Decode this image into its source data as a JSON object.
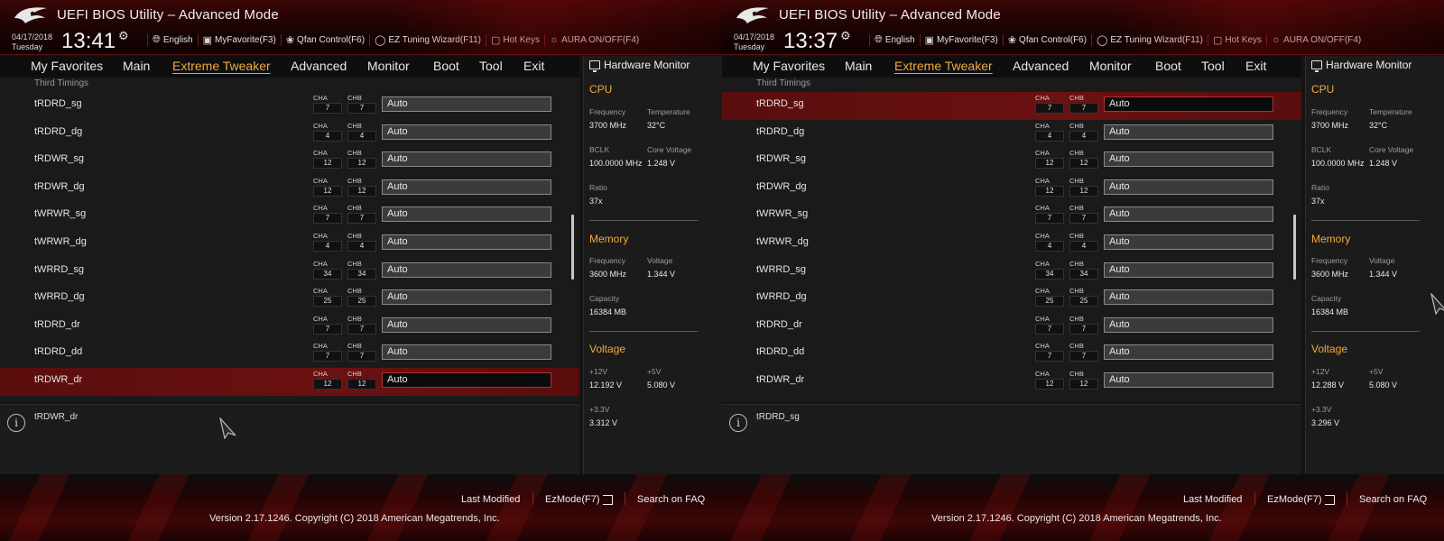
{
  "screens": [
    {
      "title": "UEFI BIOS Utility – Advanced Mode",
      "date": "04/17/2018",
      "weekday": "Tuesday",
      "time": "13:41",
      "header_menu": {
        "language": "English",
        "my_favorite": "MyFavorite(F3)",
        "qfan": "Qfan Control(F6)",
        "ez_tuning": "EZ Tuning Wizard(F11)",
        "hot_keys": "Hot Keys",
        "aura": "AURA ON/OFF(F4)"
      },
      "tabs": [
        "My Favorites",
        "Main",
        "Extreme Tweaker",
        "Advanced",
        "Monitor",
        "Boot",
        "Tool",
        "Exit"
      ],
      "active_tab": "Extreme Tweaker",
      "section": "Third Timings",
      "channel_labels": {
        "a": "CHA",
        "b": "CHB"
      },
      "rows": [
        {
          "label": "tRDRD_sg",
          "cha": "7",
          "chb": "7",
          "value": "Auto"
        },
        {
          "label": "tRDRD_dg",
          "cha": "4",
          "chb": "4",
          "value": "Auto"
        },
        {
          "label": "tRDWR_sg",
          "cha": "12",
          "chb": "12",
          "value": "Auto"
        },
        {
          "label": "tRDWR_dg",
          "cha": "12",
          "chb": "12",
          "value": "Auto"
        },
        {
          "label": "tWRWR_sg",
          "cha": "7",
          "chb": "7",
          "value": "Auto"
        },
        {
          "label": "tWRWR_dg",
          "cha": "4",
          "chb": "4",
          "value": "Auto"
        },
        {
          "label": "tWRRD_sg",
          "cha": "34",
          "chb": "34",
          "value": "Auto"
        },
        {
          "label": "tWRRD_dg",
          "cha": "25",
          "chb": "25",
          "value": "Auto"
        },
        {
          "label": "tRDRD_dr",
          "cha": "7",
          "chb": "7",
          "value": "Auto"
        },
        {
          "label": "tRDRD_dd",
          "cha": "7",
          "chb": "7",
          "value": "Auto"
        },
        {
          "label": "tRDWR_dr",
          "cha": "12",
          "chb": "12",
          "value": "Auto"
        }
      ],
      "selected_row": "tRDWR_dr",
      "help_text": "tRDWR_dr",
      "hw": {
        "title": "Hardware Monitor",
        "cpu": "CPU",
        "frequency_label": "Frequency",
        "frequency": "3700 MHz",
        "temperature_label": "Temperature",
        "temperature": "32°C",
        "bclk_label": "BCLK",
        "bclk": "100.0000 MHz",
        "core_voltage_label": "Core Voltage",
        "core_voltage": "1.248 V",
        "ratio_label": "Ratio",
        "ratio": "37x",
        "memory": "Memory",
        "mem_freq_label": "Frequency",
        "mem_freq": "3600 MHz",
        "mem_volt_label": "Voltage",
        "mem_volt": "1.344 V",
        "capacity_label": "Capacity",
        "capacity": "16384 MB",
        "voltage": "Voltage",
        "v12_label": "+12V",
        "v12": "12.192 V",
        "v5_label": "+5V",
        "v5": "5.080 V",
        "v33_label": "+3.3V",
        "v33": "3.312 V"
      },
      "footer": {
        "last_modified": "Last Modified",
        "ezmode": "EzMode(F7)",
        "search": "Search on FAQ",
        "copyright": "Version 2.17.1246. Copyright (C) 2018 American Megatrends, Inc."
      }
    },
    {
      "title": "UEFI BIOS Utility – Advanced Mode",
      "date": "04/17/2018",
      "weekday": "Tuesday",
      "time": "13:37",
      "header_menu": {
        "language": "English",
        "my_favorite": "MyFavorite(F3)",
        "qfan": "Qfan Control(F6)",
        "ez_tuning": "EZ Tuning Wizard(F11)",
        "hot_keys": "Hot Keys",
        "aura": "AURA ON/OFF(F4)"
      },
      "tabs": [
        "My Favorites",
        "Main",
        "Extreme Tweaker",
        "Advanced",
        "Monitor",
        "Boot",
        "Tool",
        "Exit"
      ],
      "active_tab": "Extreme Tweaker",
      "section": "Third Timings",
      "channel_labels": {
        "a": "CHA",
        "b": "CHB"
      },
      "rows": [
        {
          "label": "tRDRD_sg",
          "cha": "7",
          "chb": "7",
          "value": "Auto"
        },
        {
          "label": "tRDRD_dg",
          "cha": "4",
          "chb": "4",
          "value": "Auto"
        },
        {
          "label": "tRDWR_sg",
          "cha": "12",
          "chb": "12",
          "value": "Auto"
        },
        {
          "label": "tRDWR_dg",
          "cha": "12",
          "chb": "12",
          "value": "Auto"
        },
        {
          "label": "tWRWR_sg",
          "cha": "7",
          "chb": "7",
          "value": "Auto"
        },
        {
          "label": "tWRWR_dg",
          "cha": "4",
          "chb": "4",
          "value": "Auto"
        },
        {
          "label": "tWRRD_sg",
          "cha": "34",
          "chb": "34",
          "value": "Auto"
        },
        {
          "label": "tWRRD_dg",
          "cha": "25",
          "chb": "25",
          "value": "Auto"
        },
        {
          "label": "tRDRD_dr",
          "cha": "7",
          "chb": "7",
          "value": "Auto"
        },
        {
          "label": "tRDRD_dd",
          "cha": "7",
          "chb": "7",
          "value": "Auto"
        },
        {
          "label": "tRDWR_dr",
          "cha": "12",
          "chb": "12",
          "value": "Auto"
        }
      ],
      "selected_row": "tRDRD_sg",
      "help_text": "tRDRD_sg",
      "hw": {
        "title": "Hardware Monitor",
        "cpu": "CPU",
        "frequency_label": "Frequency",
        "frequency": "3700 MHz",
        "temperature_label": "Temperature",
        "temperature": "32°C",
        "bclk_label": "BCLK",
        "bclk": "100.0000 MHz",
        "core_voltage_label": "Core Voltage",
        "core_voltage": "1.248 V",
        "ratio_label": "Ratio",
        "ratio": "37x",
        "memory": "Memory",
        "mem_freq_label": "Frequency",
        "mem_freq": "3600 MHz",
        "mem_volt_label": "Voltage",
        "mem_volt": "1.344 V",
        "capacity_label": "Capacity",
        "capacity": "16384 MB",
        "voltage": "Voltage",
        "v12_label": "+12V",
        "v12": "12.288 V",
        "v5_label": "+5V",
        "v5": "5.080 V",
        "v33_label": "+3.3V",
        "v33": "3.296 V"
      },
      "footer": {
        "last_modified": "Last Modified",
        "ezmode": "EzMode(F7)",
        "search": "Search on FAQ",
        "copyright": "Version 2.17.1246. Copyright (C) 2018 American Megatrends, Inc."
      }
    }
  ]
}
